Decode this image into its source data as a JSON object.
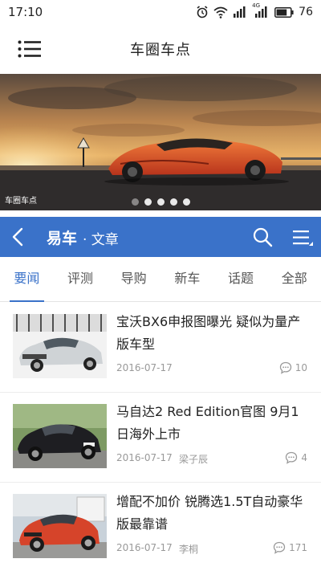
{
  "status_bar": {
    "time": "17:10",
    "network": "4G",
    "battery": "76"
  },
  "header": {
    "title": "车圈车点"
  },
  "banner": {
    "caption": "车圈车点",
    "slide_count": 5,
    "active_slide": 1
  },
  "yiche": {
    "logo": "易车",
    "subtitle": "· 文章"
  },
  "tabs": [
    "要闻",
    "评测",
    "导购",
    "新车",
    "话题",
    "全部"
  ],
  "active_tab": 0,
  "articles": [
    {
      "title": "宝沃BX6申报图曝光 疑似为量产版车型",
      "date": "2016-07-17",
      "author": "",
      "comments": "10"
    },
    {
      "title": "马自达2 Red Edition官图 9月1日海外上市",
      "date": "2016-07-17",
      "author": "梁子辰",
      "comments": "4"
    },
    {
      "title": "增配不加价 锐腾选1.5T自动豪华版最靠谱",
      "date": "2016-07-17",
      "author": "李桐",
      "comments": "171"
    }
  ],
  "colors": {
    "brand_blue": "#3a72c9",
    "active_tab": "#3a72c9",
    "meta_text": "#999999"
  }
}
